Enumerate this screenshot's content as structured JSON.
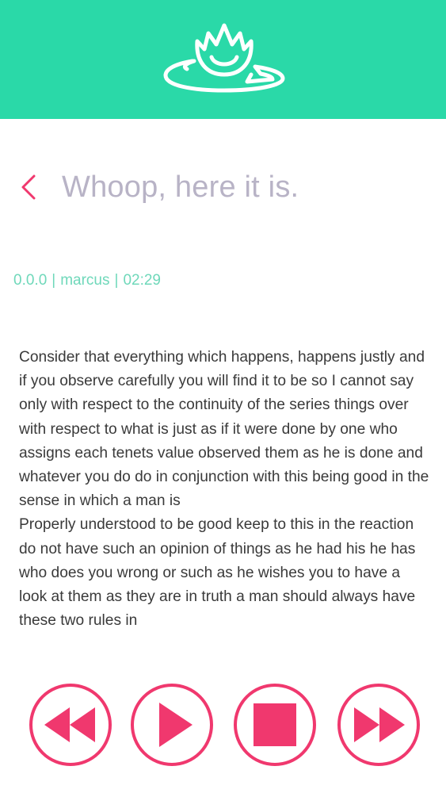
{
  "header": {
    "logo_icon": "lotus-on-lily-pad-icon",
    "background": "#2ad9a8"
  },
  "nav": {
    "back_icon": "chevron-left-icon",
    "title": "Whoop, here it is."
  },
  "meta": {
    "version": "0.0.0",
    "author": "marcus",
    "time": "02:29",
    "separator": "|"
  },
  "content": {
    "paragraphs": [
      "Consider that everything which happens, happens justly and if you observe carefully you will find it to be so I cannot say only with respect to the continuity of the series things over with respect to what is just as if it were done by one who assigns each tenets value observed them as he is done and whatever you do do in conjunction with this being good in the sense in which a man is",
      "Properly understood to be good keep to this in the reaction do not have such an opinion of things as he had his he has who does you wrong or such as he wishes you to have a look at them as they are in truth a man should always have these two rules in"
    ]
  },
  "controls": {
    "accent": "#f0386e",
    "buttons": [
      {
        "icon": "rewind-icon"
      },
      {
        "icon": "play-icon"
      },
      {
        "icon": "stop-icon"
      },
      {
        "icon": "fast-forward-icon"
      }
    ]
  }
}
